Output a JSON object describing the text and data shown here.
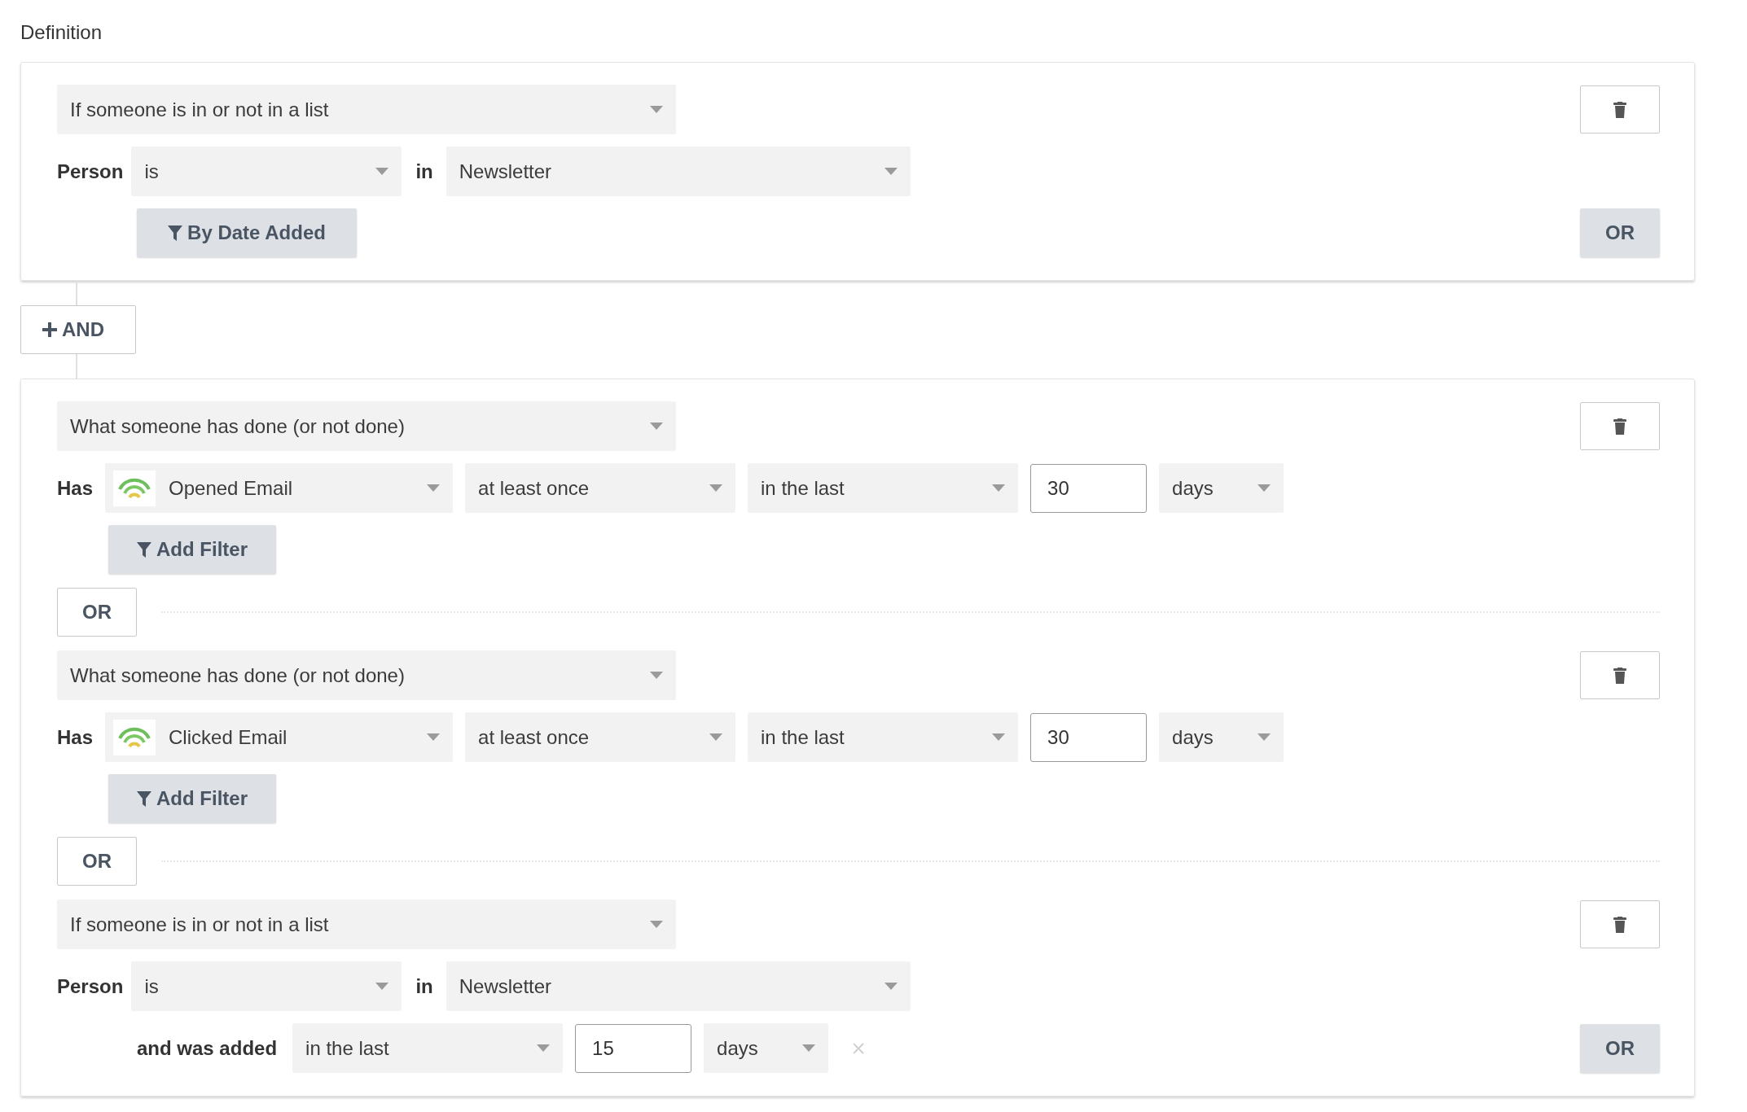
{
  "heading": "Definition",
  "and_button": "AND",
  "groups": [
    {
      "or_button": "OR",
      "conditions": [
        {
          "kind": "list",
          "type_select": "If someone is in or not in a list",
          "subject_label": "Person",
          "operator": "is",
          "connector": "in",
          "list": "Newsletter",
          "filter_button": "By Date Added"
        }
      ]
    },
    {
      "conditions": [
        {
          "kind": "event",
          "type_select": "What someone has done (or not done)",
          "subject_label": "Has",
          "event": "Opened Email",
          "frequency": "at least once",
          "timeframe": "in the last",
          "amount": "30",
          "unit": "days",
          "filter_button": "Add Filter"
        },
        {
          "kind": "event",
          "separator": "OR",
          "type_select": "What someone has done (or not done)",
          "subject_label": "Has",
          "event": "Clicked Email",
          "frequency": "at least once",
          "timeframe": "in the last",
          "amount": "30",
          "unit": "days",
          "filter_button": "Add Filter"
        },
        {
          "kind": "list",
          "separator": "OR",
          "type_select": "If someone is in or not in a list",
          "subject_label": "Person",
          "operator": "is",
          "connector": "in",
          "list": "Newsletter",
          "date_filter": {
            "label": "and was added",
            "timeframe": "in the last",
            "amount": "15",
            "unit": "days"
          }
        }
      ],
      "or_button": "OR"
    }
  ]
}
